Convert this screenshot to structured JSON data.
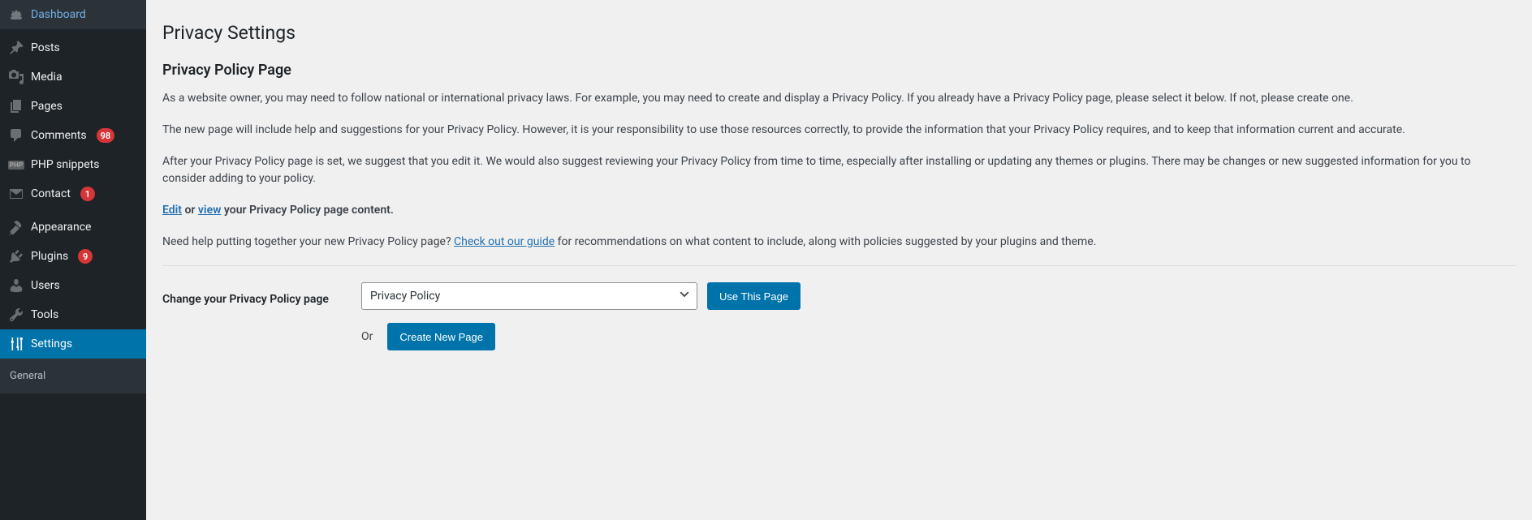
{
  "sidebar": {
    "items": [
      {
        "label": "Dashboard",
        "icon": "dashboard"
      },
      {
        "label": "Posts",
        "icon": "pin"
      },
      {
        "label": "Media",
        "icon": "media"
      },
      {
        "label": "Pages",
        "icon": "pages"
      },
      {
        "label": "Comments",
        "icon": "comment",
        "badge": "98"
      },
      {
        "label": "PHP snippets",
        "icon": "php"
      },
      {
        "label": "Contact",
        "icon": "mail",
        "badge": "1"
      },
      {
        "label": "Appearance",
        "icon": "brush"
      },
      {
        "label": "Plugins",
        "icon": "plug",
        "badge": "9"
      },
      {
        "label": "Users",
        "icon": "user"
      },
      {
        "label": "Tools",
        "icon": "wrench"
      },
      {
        "label": "Settings",
        "icon": "sliders",
        "current": true
      }
    ],
    "submenu": [
      {
        "label": "General"
      }
    ]
  },
  "page": {
    "title": "Privacy Settings",
    "subtitle": "Privacy Policy Page",
    "para1": "As a website owner, you may need to follow national or international privacy laws. For example, you may need to create and display a Privacy Policy. If you already have a Privacy Policy page, please select it below. If not, please create one.",
    "para2": "The new page will include help and suggestions for your Privacy Policy. However, it is your responsibility to use those resources correctly, to provide the information that your Privacy Policy requires, and to keep that information current and accurate.",
    "para3": "After your Privacy Policy page is set, we suggest that you edit it. We would also suggest reviewing your Privacy Policy from time to time, especially after installing or updating any themes or plugins. There may be changes or new suggested information for you to consider adding to your policy.",
    "edit_link": "Edit",
    "or_text": " or ",
    "view_link": "view",
    "para4_suffix": " your Privacy Policy page content.",
    "para5_prefix": "Need help putting together your new Privacy Policy page? ",
    "guide_link": "Check out our guide",
    "para5_suffix": " for recommendations on what content to include, along with policies suggested by your plugins and theme.",
    "form_label": "Change your Privacy Policy page",
    "select_value": "Privacy Policy",
    "use_button": "Use This Page",
    "or_label": "Or",
    "create_button": "Create New Page"
  }
}
